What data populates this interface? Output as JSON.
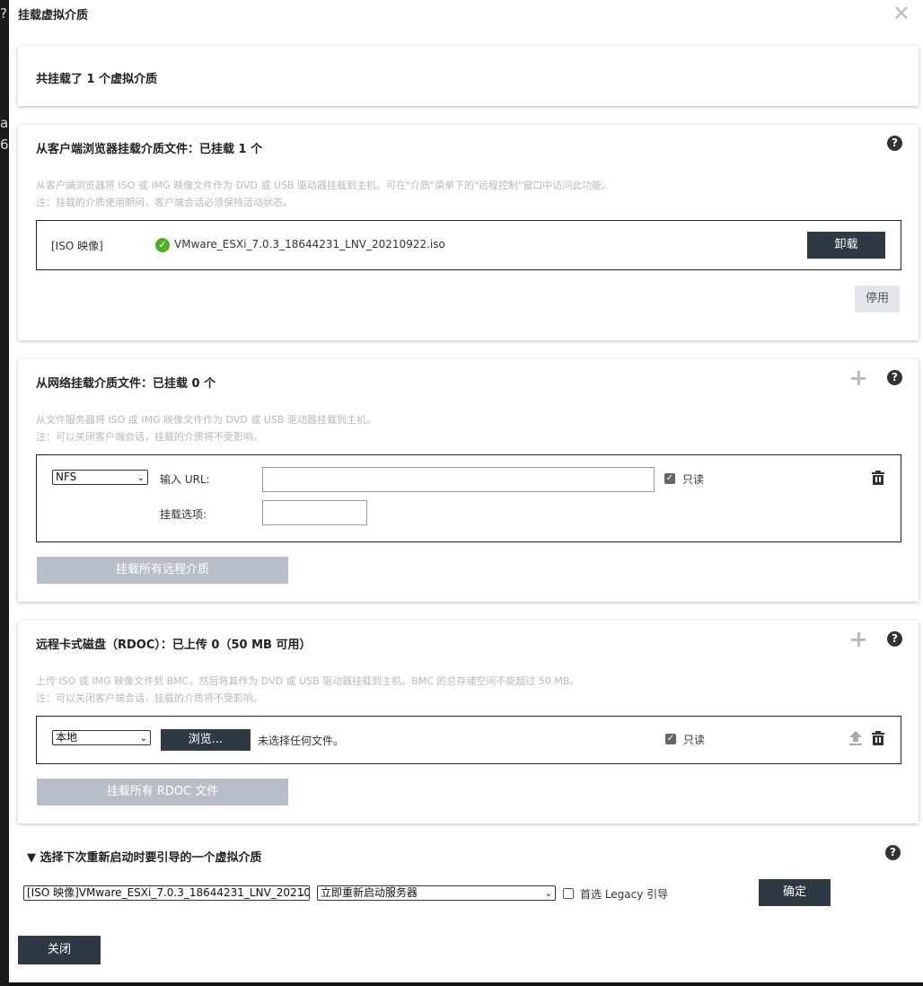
{
  "dialog": {
    "title": "挂载虚拟介质"
  },
  "summary": {
    "text": "共挂载了 1 个虚拟介质"
  },
  "browser_media": {
    "title": "从客户端浏览器挂载介质文件：已挂载 1 个",
    "desc_line1": "从客户端浏览器将 ISO 或 IMG 映像文件作为 DVD 或 USB 驱动器挂载到主机。可在\"介质\"菜单下的\"远程控制\"窗口中访问此功能。",
    "desc_line2": "注：挂载的介质使用期间，客户端会话必须保持活动状态。",
    "row": {
      "type": "[ISO 映像]",
      "file": "VMware_ESXi_7.0.3_18644231_LNV_20210922.iso"
    },
    "unmount_label": "卸载",
    "disable_label": "停用"
  },
  "network_media": {
    "title": "从网络挂载介质文件：已挂载 0 个",
    "desc_line1": "从文件服务器将 ISO 或 IMG 映像文件作为 DVD 或 USB 驱动器挂载到主机。",
    "desc_line2": "注：可以关闭客户端会话，挂载的介质将不受影响。",
    "protocol_selected": "NFS",
    "url_label": "输入 URL:",
    "url_value": "",
    "mount_options_label": "挂载选项:",
    "mount_options_value": "",
    "readonly_label": "只读",
    "mount_all_label": "挂载所有远程介质"
  },
  "rdoc": {
    "title": "远程卡式磁盘（RDOC）：已上传 0（50 MB 可用）",
    "desc_line1": "上传 ISO 或 IMG 映像文件到 BMC，然后将其作为 DVD 或 USB 驱动器挂载到主机。BMC 的总存储空间不能超过 50 MB。",
    "desc_line2": "注：可以关闭客户端会话，挂载的介质将不受影响。",
    "source_selected": "本地",
    "browse_label": "浏览...",
    "no_file_text": "未选择任何文件。",
    "readonly_label": "只读",
    "mount_all_label": "挂载所有 RDOC 文件"
  },
  "boot": {
    "title": "▼ 选择下次重新启动时要引导的一个虚拟介质",
    "media_selected": "[ISO 映像]VMware_ESXi_7.0.3_18644231_LNV_20210",
    "action_selected": "立即重新启动服务器",
    "legacy_label": "首选 Legacy 引导",
    "confirm_label": "确定"
  },
  "footer": {
    "close_label": "关闭"
  },
  "icons": {
    "help": "?",
    "ok": "✓",
    "close": "✕",
    "caret": "⌄",
    "check": "✓"
  },
  "background": {
    "fragment1": "a",
    "fragment2": "6"
  }
}
